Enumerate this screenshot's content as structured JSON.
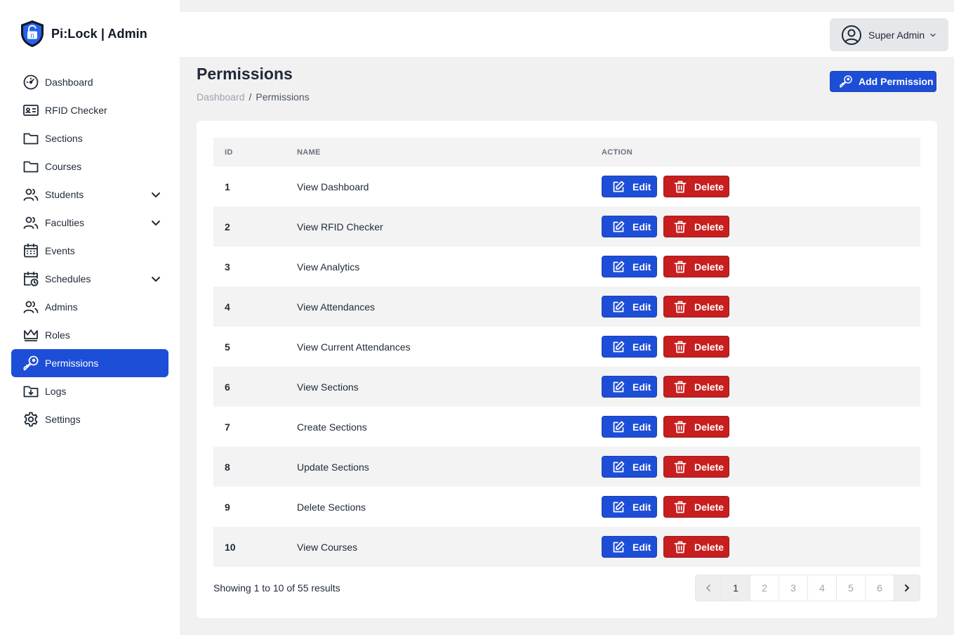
{
  "app": {
    "brand": "Pi:Lock | Admin"
  },
  "sidebar": {
    "items": [
      {
        "label": "Dashboard",
        "icon": "gauge-icon"
      },
      {
        "label": "RFID Checker",
        "icon": "id-card-icon"
      },
      {
        "label": "Sections",
        "icon": "folder-icon"
      },
      {
        "label": "Courses",
        "icon": "folder-icon"
      },
      {
        "label": "Students",
        "icon": "users-icon",
        "expandable": true
      },
      {
        "label": "Faculties",
        "icon": "users-icon",
        "expandable": true
      },
      {
        "label": "Events",
        "icon": "calendar-icon"
      },
      {
        "label": "Schedules",
        "icon": "calendar-clock-icon",
        "expandable": true
      },
      {
        "label": "Admins",
        "icon": "users-icon"
      },
      {
        "label": "Roles",
        "icon": "crown-icon"
      },
      {
        "label": "Permissions",
        "icon": "key-icon",
        "active": true
      },
      {
        "label": "Logs",
        "icon": "folder-download-icon"
      },
      {
        "label": "Settings",
        "icon": "gear-icon"
      }
    ]
  },
  "header": {
    "user": "Super Admin"
  },
  "page": {
    "title": "Permissions",
    "breadcrumb": {
      "root": "Dashboard",
      "separator": "/",
      "current": "Permissions"
    },
    "add_button": "Add Permission"
  },
  "table": {
    "headers": {
      "id": "ID",
      "name": "NAME",
      "action": "ACTION"
    },
    "edit_label": "Edit",
    "delete_label": "Delete",
    "rows": [
      {
        "id": "1",
        "name": "View Dashboard"
      },
      {
        "id": "2",
        "name": "View RFID Checker"
      },
      {
        "id": "3",
        "name": "View Analytics"
      },
      {
        "id": "4",
        "name": "View Attendances"
      },
      {
        "id": "5",
        "name": "View Current Attendances"
      },
      {
        "id": "6",
        "name": "View Sections"
      },
      {
        "id": "7",
        "name": "Create Sections"
      },
      {
        "id": "8",
        "name": "Update Sections"
      },
      {
        "id": "9",
        "name": "Delete Sections"
      },
      {
        "id": "10",
        "name": "View Courses"
      }
    ]
  },
  "pagination": {
    "summary": {
      "prefix": "Showing ",
      "from": "1",
      "to_word": " to ",
      "to": "10",
      "of_word": " of ",
      "total": "55",
      "suffix": " results"
    },
    "pages": [
      "1",
      "2",
      "3",
      "4",
      "5",
      "6"
    ],
    "current": "1"
  },
  "colors": {
    "primary": "#1d4ed8",
    "danger": "#c81e1e",
    "background": "#f1f1f1"
  }
}
